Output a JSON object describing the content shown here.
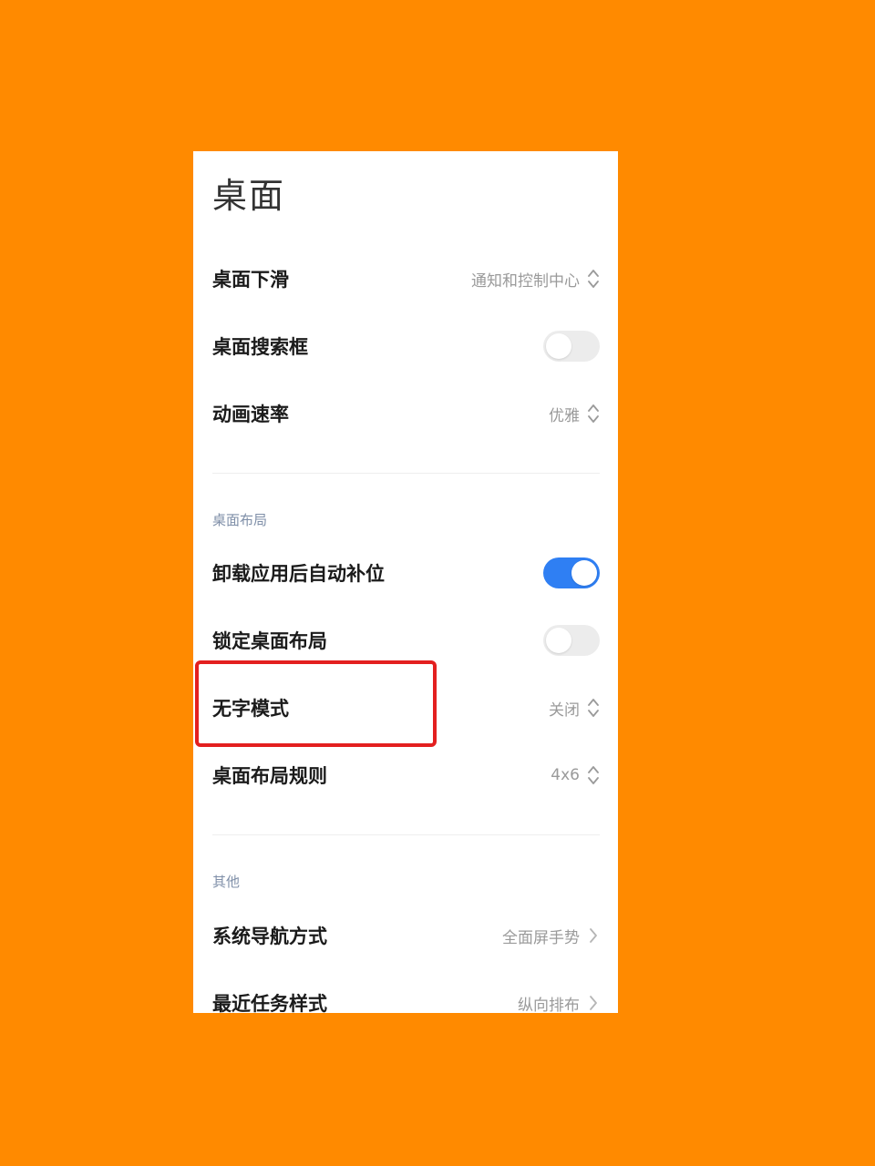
{
  "page": {
    "title": "桌面"
  },
  "rows_top": [
    {
      "label": "桌面下滑",
      "value": "通知和控制中心",
      "control": "select"
    },
    {
      "label": "桌面搜索框",
      "control": "toggle",
      "on": false
    },
    {
      "label": "动画速率",
      "value": "优雅",
      "control": "select"
    }
  ],
  "section_layout": {
    "header": "桌面布局",
    "rows": [
      {
        "label": "卸载应用后自动补位",
        "control": "toggle",
        "on": true
      },
      {
        "label": "锁定桌面布局",
        "control": "toggle",
        "on": false
      },
      {
        "label": "无字模式",
        "value": "关闭",
        "control": "select"
      },
      {
        "label": "桌面布局规则",
        "value": "4x6",
        "control": "select"
      }
    ]
  },
  "section_other": {
    "header": "其他",
    "rows": [
      {
        "label": "系统导航方式",
        "value": "全面屏手势",
        "control": "link"
      },
      {
        "label": "最近任务样式",
        "value": "纵向排布",
        "control": "link"
      }
    ]
  },
  "colors": {
    "background": "#FF8A00",
    "toggle_on": "#2f7ff3",
    "toggle_off": "#ececec",
    "highlight": "#e32020",
    "section_header": "#7f8fa8"
  },
  "icons": {
    "select": "up-down-arrows-icon",
    "link": "chevron-right-icon"
  }
}
